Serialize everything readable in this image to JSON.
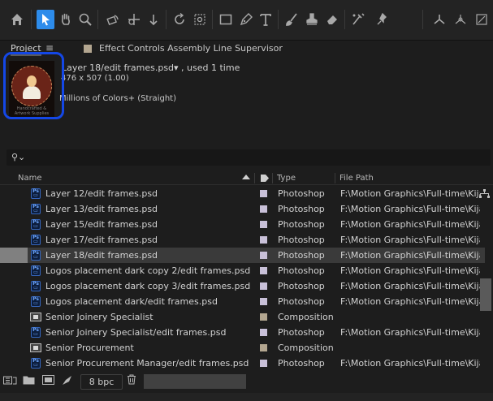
{
  "toolbar": {
    "tools": [
      "home-icon",
      "selection-icon",
      "hand-icon",
      "zoom-icon",
      "orbit-icon",
      "pan-behind-icon",
      "dolly-icon",
      "rotate-icon",
      "anchor-icon",
      "rectangle-icon",
      "pen-icon",
      "type-icon",
      "brush-icon",
      "clone-stamp-icon",
      "eraser-icon",
      "roto-brush-icon",
      "puppet-pin-icon",
      "axis-local-icon",
      "axis-world-icon",
      "axis-view-icon"
    ]
  },
  "panel": {
    "project_tab": "Project",
    "menu_glyph": "≡",
    "effect_controls_tab": "Effect Controls Assembly Line Supervisor"
  },
  "preview": {
    "name": "Layer 18/edit frames.psd▾ , used 1 time",
    "dimensions": "476 x 507 (1.00)",
    "colors": "Millions of Colors+ (Straight)",
    "thumb_caption": "Handcrafted & Artwork Supplies"
  },
  "search": {
    "value": "",
    "placeholder": ""
  },
  "table": {
    "headers": {
      "name": "Name",
      "type": "Type",
      "path": "File Path"
    },
    "rows": [
      {
        "icon": "psd",
        "name": "Layer 12/edit frames.psd",
        "type": "Photoshop",
        "path": "F:\\Motion Graphics\\Full-time\\Kijam",
        "label": "#c8c0d8",
        "selected": false
      },
      {
        "icon": "psd",
        "name": "Layer 13/edit frames.psd",
        "type": "Photoshop",
        "path": "F:\\Motion Graphics\\Full-time\\Kijam",
        "label": "#c8c0d8",
        "selected": false
      },
      {
        "icon": "psd",
        "name": "Layer 15/edit frames.psd",
        "type": "Photoshop",
        "path": "F:\\Motion Graphics\\Full-time\\Kijam",
        "label": "#c8c0d8",
        "selected": false
      },
      {
        "icon": "psd",
        "name": "Layer 17/edit frames.psd",
        "type": "Photoshop",
        "path": "F:\\Motion Graphics\\Full-time\\Kijam",
        "label": "#c8c0d8",
        "selected": false
      },
      {
        "icon": "psd",
        "name": "Layer 18/edit frames.psd",
        "type": "Photoshop",
        "path": "F:\\Motion Graphics\\Full-time\\Kijam",
        "label": "#c8c0d8",
        "selected": true
      },
      {
        "icon": "psd",
        "name": "Logos placement dark copy 2/edit frames.psd",
        "type": "Photoshop",
        "path": "F:\\Motion Graphics\\Full-time\\Kijam",
        "label": "#c8c0d8",
        "selected": false
      },
      {
        "icon": "psd",
        "name": "Logos placement dark copy 3/edit frames.psd",
        "type": "Photoshop",
        "path": "F:\\Motion Graphics\\Full-time\\Kijam",
        "label": "#c8c0d8",
        "selected": false
      },
      {
        "icon": "psd",
        "name": "Logos placement dark/edit frames.psd",
        "type": "Photoshop",
        "path": "F:\\Motion Graphics\\Full-time\\Kijam",
        "label": "#c8c0d8",
        "selected": false
      },
      {
        "icon": "comp",
        "name": "Senior Joinery Specialist",
        "type": "Composition",
        "path": "",
        "label": "#b3a690",
        "selected": false
      },
      {
        "icon": "psd",
        "name": "Senior Joinery Specialist/edit frames.psd",
        "type": "Photoshop",
        "path": "F:\\Motion Graphics\\Full-time\\Kijam",
        "label": "#c8c0d8",
        "selected": false
      },
      {
        "icon": "comp",
        "name": "Senior Procurement",
        "type": "Composition",
        "path": "",
        "label": "#b3a690",
        "selected": false
      },
      {
        "icon": "psd",
        "name": "Senior Procurement Manager/edit frames.psd",
        "type": "Photoshop",
        "path": "F:\\Motion Graphics\\Full-time\\Kijam",
        "label": "#c8c0d8",
        "selected": false
      }
    ]
  },
  "footer": {
    "bpc": "8 bpc"
  },
  "colors": {
    "accent": "#2d8ceb",
    "highlight": "#1447e6",
    "psd_label": "#c8c0d8",
    "comp_label": "#b3a690"
  }
}
